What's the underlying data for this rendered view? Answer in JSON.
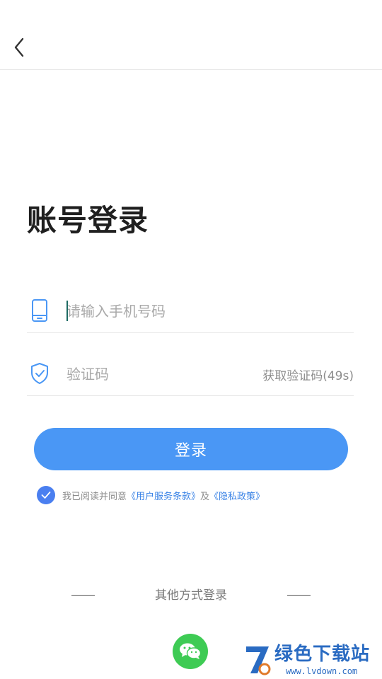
{
  "header": {
    "back_icon": "chevron-left-icon"
  },
  "page": {
    "title": "账号登录"
  },
  "form": {
    "phone": {
      "icon": "phone-icon",
      "placeholder": "请输入手机号码",
      "value": ""
    },
    "code": {
      "icon": "shield-check-icon",
      "placeholder": "验证码",
      "value": "",
      "get_code_label": "获取验证码(49s)"
    },
    "submit_label": "登录"
  },
  "agreement": {
    "checked": true,
    "prefix": "我已阅读并同意",
    "terms_link": "《用户服务条款》",
    "conjunction": "及",
    "privacy_link": "《隐私政策》"
  },
  "other_login": {
    "label": "其他方式登录",
    "wechat_icon": "wechat-icon"
  },
  "watermark": {
    "title": "绿色下载站",
    "url": "www.lvdown.com"
  },
  "colors": {
    "primary": "#4a97f5",
    "link": "#3a83e6",
    "check": "#4a7ff0",
    "wechat": "#3ecb54"
  }
}
